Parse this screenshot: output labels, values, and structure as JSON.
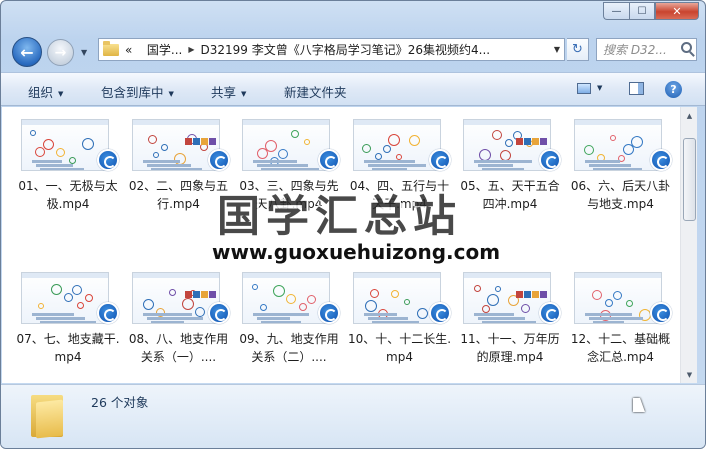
{
  "window": {
    "controls": {
      "minimize": "—",
      "maximize": "☐",
      "close": "✕"
    }
  },
  "nav": {
    "address_segments": [
      "国学...",
      "D32199 李文曾《八字格局学习笔记》26集视频约4..."
    ],
    "address_prefix": "«",
    "search_placeholder": "搜索 D32...",
    "back_icon": "back-arrow-icon",
    "forward_icon": "forward-arrow-icon"
  },
  "toolbar": {
    "organize": "组织",
    "include_in_library": "包含到库中",
    "share": "共享",
    "new_folder": "新建文件夹"
  },
  "files": [
    {
      "label": "01、一、无极与太极.mp4"
    },
    {
      "label": "02、二、四象与五行.mp4"
    },
    {
      "label": "03、三、四象与先天八卦.mp4"
    },
    {
      "label": "04、四、五行与十天干.mp4"
    },
    {
      "label": "05、五、天干五合四冲.mp4"
    },
    {
      "label": "06、六、后天八卦与地支.mp4"
    },
    {
      "label": "07、七、地支藏干.mp4"
    },
    {
      "label": "08、八、地支作用关系（一）...."
    },
    {
      "label": "09、九、地支作用关系（二）...."
    },
    {
      "label": "10、十、十二长生.mp4"
    },
    {
      "label": "11、十一、万年历的原理.mp4"
    },
    {
      "label": "12、十二、基础概念汇总.mp4"
    }
  ],
  "watermark": {
    "title": "国学汇总站",
    "url": "www.guoxuehuizong.com"
  },
  "status": {
    "count_text": "26 个对象"
  }
}
